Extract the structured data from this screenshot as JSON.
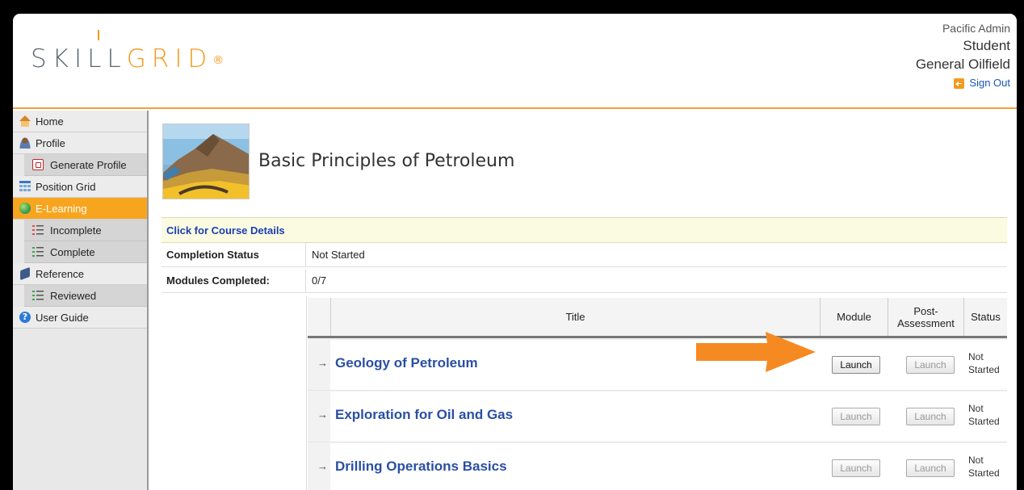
{
  "header": {
    "logo_part1": "SKILL",
    "logo_part2": "GRID",
    "logo_reg": "®",
    "user_role": "Pacific Admin",
    "user_name": "Student",
    "user_dept": "General Oilfield",
    "signout_label": "Sign Out"
  },
  "sidebar": {
    "items": [
      {
        "label": "Home",
        "icon": "home-icon"
      },
      {
        "label": "Profile",
        "icon": "profile-icon"
      },
      {
        "label": "Generate Profile",
        "icon": "pdf-icon"
      },
      {
        "label": "Position Grid",
        "icon": "grid-icon"
      },
      {
        "label": "E-Learning",
        "icon": "globe-icon",
        "active": true
      },
      {
        "label": "Incomplete",
        "icon": "list-icon"
      },
      {
        "label": "Complete",
        "icon": "list-icon"
      },
      {
        "label": "Reference",
        "icon": "book-icon"
      },
      {
        "label": "Reviewed",
        "icon": "list-icon"
      },
      {
        "label": "User Guide",
        "icon": "help-icon"
      }
    ]
  },
  "course": {
    "title": "Basic Principles of Petroleum",
    "details_link": "Click for Course Details",
    "completion_label": "Completion Status",
    "completion_value": "Not Started",
    "modules_label": "Modules Completed:",
    "modules_value": "0/7"
  },
  "table": {
    "headers": {
      "title": "Title",
      "module": "Module",
      "post_assessment_1": "Post-",
      "post_assessment_2": "Assessment",
      "status": "Status"
    },
    "rows": [
      {
        "title": "Geology of Petroleum",
        "module_btn": "Launch",
        "module_enabled": true,
        "post_btn": "Launch",
        "status_1": "Not",
        "status_2": "Started"
      },
      {
        "title": "Exploration for Oil and Gas",
        "module_btn": "Launch",
        "module_enabled": false,
        "post_btn": "Launch",
        "status_1": "Not",
        "status_2": "Started"
      },
      {
        "title": "Drilling Operations Basics",
        "module_btn": "Launch",
        "module_enabled": false,
        "post_btn": "Launch",
        "status_1": "Not",
        "status_2": "Started"
      }
    ],
    "arrow_glyph": "→"
  },
  "colors": {
    "accent": "#f39a1f",
    "link": "#2a4fa3",
    "annotation_arrow": "#f58a22"
  }
}
